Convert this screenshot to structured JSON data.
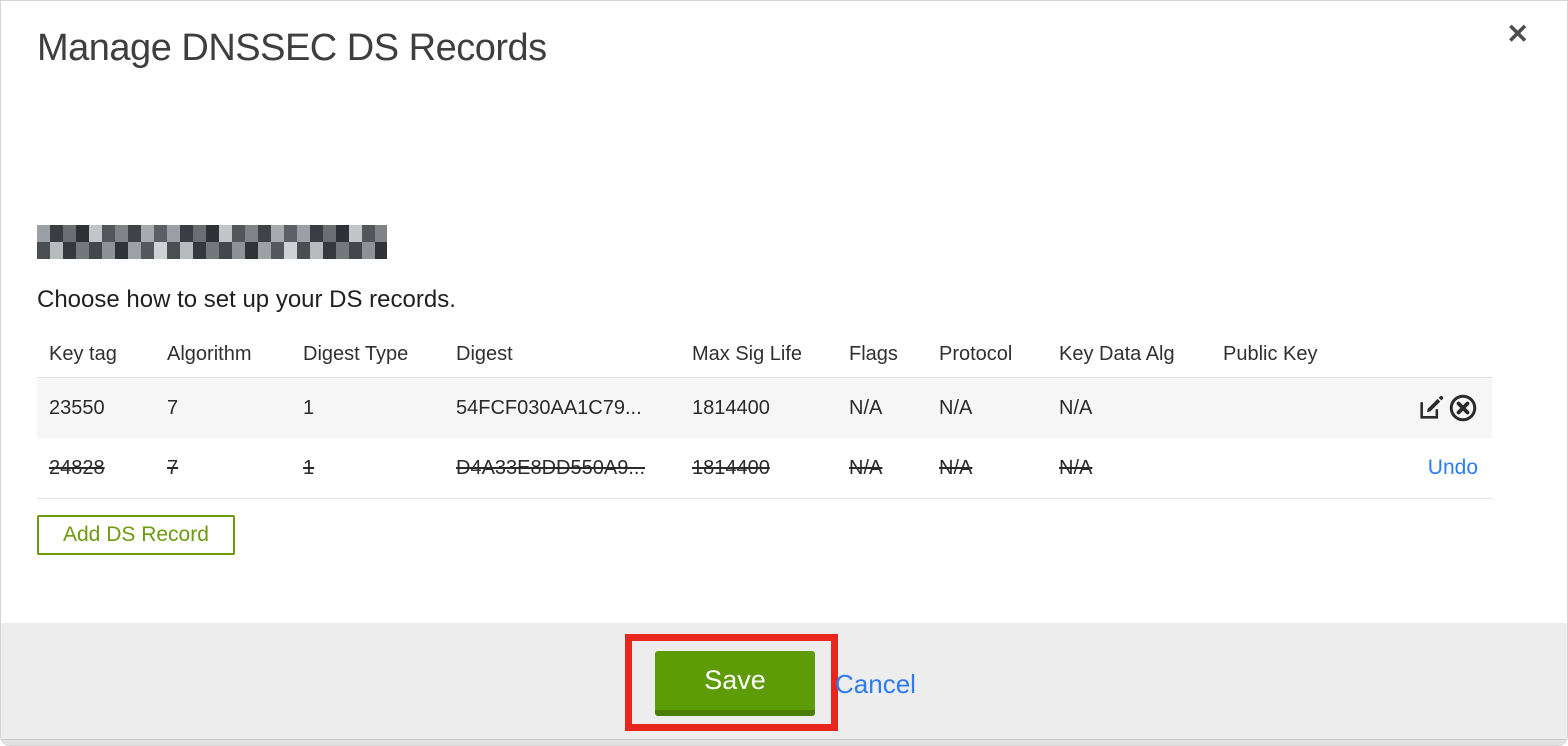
{
  "modal": {
    "title": "Manage DNSSEC DS Records",
    "close_label": "✕"
  },
  "instruction": "Choose how to set up your DS records.",
  "table": {
    "columns": [
      "Key tag",
      "Algorithm",
      "Digest Type",
      "Digest",
      "Max Sig Life",
      "Flags",
      "Protocol",
      "Key Data Alg",
      "Public Key"
    ],
    "rows": [
      {
        "cells": [
          "23550",
          "7",
          "1",
          "54FCF030AA1C79...",
          "1814400",
          "N/A",
          "N/A",
          "N/A",
          ""
        ],
        "struck": false,
        "shaded": true,
        "actions": [
          "edit",
          "delete"
        ]
      },
      {
        "cells": [
          "24828",
          "7",
          "1",
          "D4A33E8DD550A9...",
          "1814400",
          "N/A",
          "N/A",
          "N/A",
          ""
        ],
        "struck": true,
        "shaded": false,
        "actions": [
          "undo"
        ],
        "undo_label": "Undo"
      }
    ]
  },
  "buttons": {
    "add_ds_record": "Add DS Record",
    "save": "Save",
    "cancel": "Cancel"
  },
  "icons": {
    "edit": "edit-icon",
    "delete": "delete-icon"
  },
  "colors": {
    "save_green": "#5d9b07",
    "save_green_dark": "#4a7d05",
    "outline_green": "#6d9a12",
    "link_blue": "#2d7cf2",
    "annotation_red": "#e8261d",
    "row_shade": "#f6f6f6",
    "footer_gray": "#ededed"
  }
}
